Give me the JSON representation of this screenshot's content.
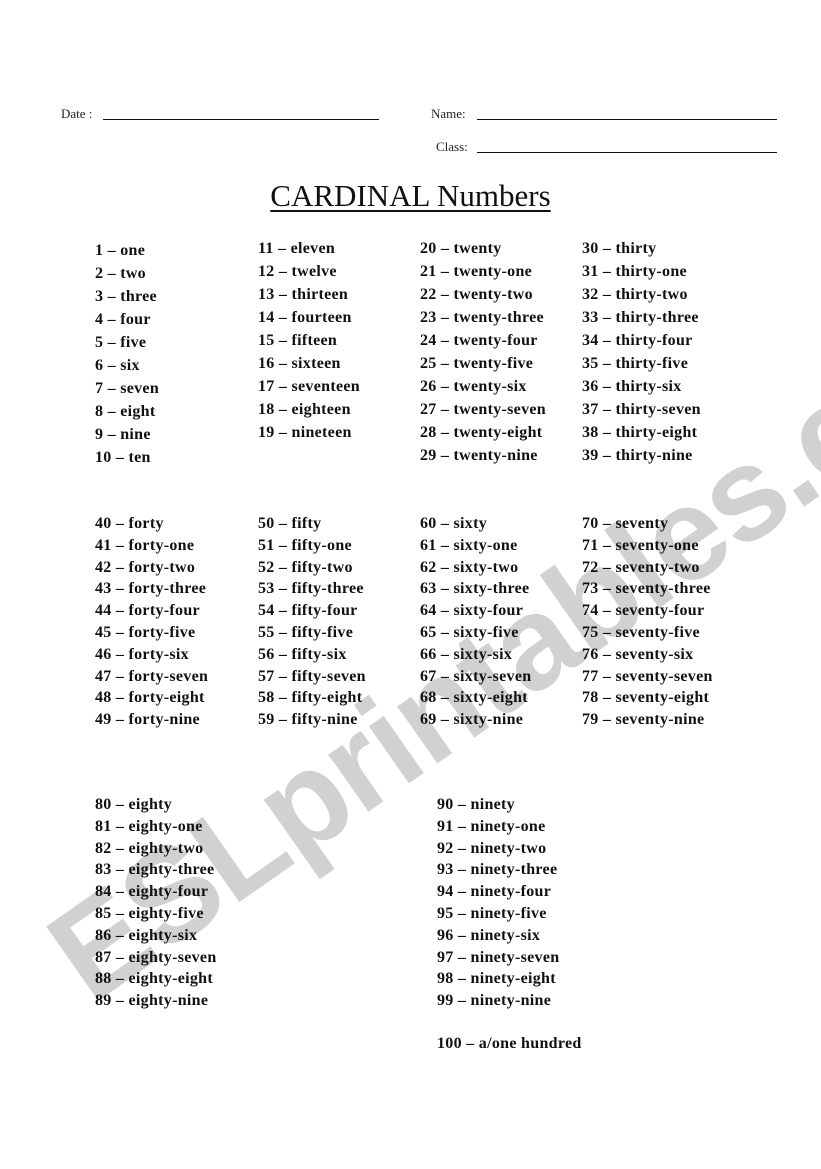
{
  "header": {
    "date_label": "Date :",
    "name_label": "Name:",
    "class_label": "Class:"
  },
  "title": "CARDINAL Numbers",
  "watermark": "ESLprintables.com",
  "sections": [
    {
      "columns": [
        [
          "1 – one",
          "2 – two",
          "3 – three",
          "4 – four",
          "5 – five",
          "6 – six",
          "7 – seven",
          "8 – eight",
          "9 – nine",
          "10 – ten"
        ],
        [
          "11 – eleven",
          "12 – twelve",
          "13 – thirteen",
          "14 – fourteen",
          "15 – fifteen",
          "16 – sixteen",
          "17 – seventeen",
          "18 – eighteen",
          "19 – nineteen"
        ],
        [
          "20 – twenty",
          "21 – twenty-one",
          "22 – twenty-two",
          "23 – twenty-three",
          "24 – twenty-four",
          "25 – twenty-five",
          "26 – twenty-six",
          "27 – twenty-seven",
          "28 – twenty-eight",
          "29 – twenty-nine"
        ],
        [
          "30 – thirty",
          "31 – thirty-one",
          "32 – thirty-two",
          "33 – thirty-three",
          "34 – thirty-four",
          "35 – thirty-five",
          "36 – thirty-six",
          "37 – thirty-seven",
          "38 – thirty-eight",
          "39 – thirty-nine"
        ]
      ]
    },
    {
      "columns": [
        [
          "40 – forty",
          "41 – forty-one",
          "42 – forty-two",
          "43 – forty-three",
          "44 – forty-four",
          "45 – forty-five",
          "46 – forty-six",
          "47 – forty-seven",
          "48 – forty-eight",
          "49 – forty-nine"
        ],
        [
          "50 – fifty",
          "51 – fifty-one",
          "52 – fifty-two",
          "53 – fifty-three",
          "54 – fifty-four",
          "55 – fifty-five",
          "56 – fifty-six",
          "57 – fifty-seven",
          "58 – fifty-eight",
          "59 – fifty-nine"
        ],
        [
          "60 – sixty",
          "61 – sixty-one",
          "62 – sixty-two",
          "63 – sixty-three",
          "64 – sixty-four",
          "65 – sixty-five",
          "66 – sixty-six",
          "67 – sixty-seven",
          "68 – sixty-eight",
          "69 – sixty-nine"
        ],
        [
          "70 – seventy",
          "71 – seventy-one",
          "72 – seventy-two",
          "73 – seventy-three",
          "74 – seventy-four",
          "75 – seventy-five",
          "76 – seventy-six",
          "77 – seventy-seven",
          "78 – seventy-eight",
          "79 – seventy-nine"
        ]
      ]
    },
    {
      "columns": [
        [
          "80 – eighty",
          "81 – eighty-one",
          "82 – eighty-two",
          "83 – eighty-three",
          "84 – eighty-four",
          "85 – eighty-five",
          "86 – eighty-six",
          "87 – eighty-seven",
          "88 – eighty-eight",
          "89 – eighty-nine"
        ],
        [
          "90 – ninety",
          "91 – ninety-one",
          "92 – ninety-two",
          "93 – ninety-three",
          "94 – ninety-four",
          "95 – ninety-five",
          "96 – ninety-six",
          "97 – ninety-seven",
          "98 – ninety-eight",
          "99 – ninety-nine"
        ]
      ]
    }
  ],
  "hundred": "100 – a/one hundred"
}
